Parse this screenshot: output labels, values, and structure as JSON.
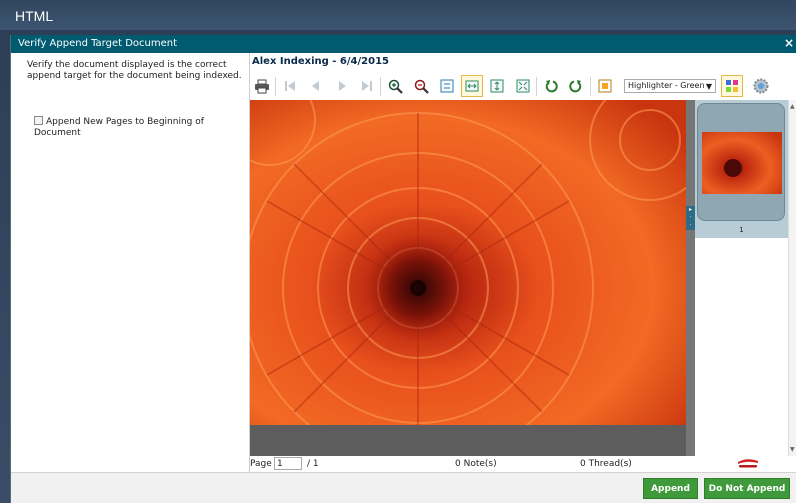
{
  "app": {
    "title": "HTML"
  },
  "dialog": {
    "title": "Verify Append Target Document",
    "close": "×"
  },
  "left": {
    "instructions": "Verify the document displayed is the correct append target for the document being indexed.",
    "checkbox_label": "Append New Pages to Beginning of Document",
    "checkbox_checked": false
  },
  "viewer": {
    "doc_title": "Alex Indexing - 6/4/2015",
    "highlighter": {
      "selected": "Highlighter - Green"
    },
    "icons": [
      "print-icon",
      "first-page-icon",
      "prev-page-icon",
      "next-page-icon",
      "last-page-icon",
      "zoom-in-icon",
      "zoom-out-icon",
      "actual-size-icon",
      "fit-width-icon",
      "fit-height-icon",
      "fit-page-icon",
      "rotate-left-icon",
      "rotate-right-icon",
      "highlight-icon",
      "annotation-view-icon",
      "settings-icon"
    ],
    "thumbnail_number": "1",
    "footer": {
      "page_label": "Page",
      "page_value": "1",
      "page_total": "/ 1",
      "notes": "0 Note(s)",
      "threads": "0 Thread(s)"
    }
  },
  "buttons": {
    "append": "Append",
    "do_not_append": "Do Not Append"
  },
  "colors": {
    "dialog_title_bg": "#005a70",
    "button_green": "#3e9a3a",
    "flower": "#e8501c"
  }
}
